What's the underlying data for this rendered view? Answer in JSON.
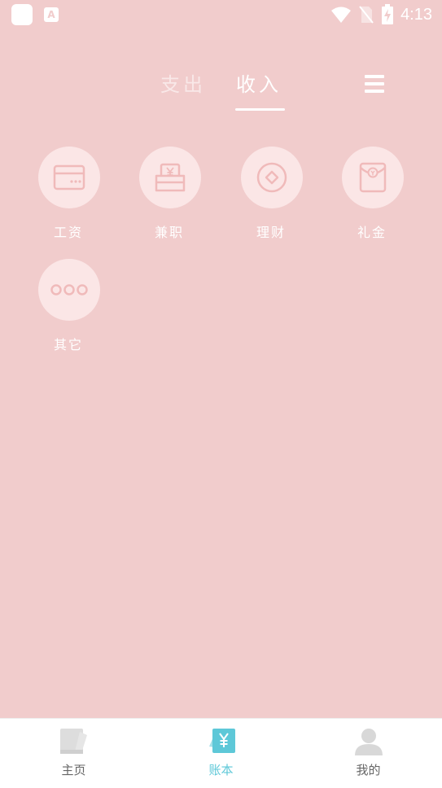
{
  "status_bar": {
    "time": "4:13",
    "notification_glyph": "A",
    "icons": [
      "app-notification-icon",
      "a-notification-icon",
      "wifi-icon",
      "no-sim-icon",
      "battery-charging-icon"
    ]
  },
  "tabs": {
    "expense_label": "支出",
    "income_label": "收入",
    "active": "income"
  },
  "categories": [
    {
      "label": "工资",
      "icon": "wallet-card-icon"
    },
    {
      "label": "兼职",
      "icon": "yuan-bag-icon"
    },
    {
      "label": "理财",
      "icon": "coin-icon"
    },
    {
      "label": "礼金",
      "icon": "red-envelope-icon"
    },
    {
      "label": "其它",
      "icon": "more-dots-icon"
    }
  ],
  "bottom_nav": {
    "active": "ledger",
    "items": [
      {
        "label": "主页",
        "icon": "home-book-icon"
      },
      {
        "label": "账本",
        "icon": "ledger-yuan-icon"
      },
      {
        "label": "我的",
        "icon": "user-profile-icon"
      }
    ]
  },
  "colors": {
    "background": "#f1cccc",
    "circle": "#fbe6e6",
    "icon_stroke": "#f0baba",
    "accent": "#5ec8d8",
    "nav_inactive": "#666666"
  }
}
